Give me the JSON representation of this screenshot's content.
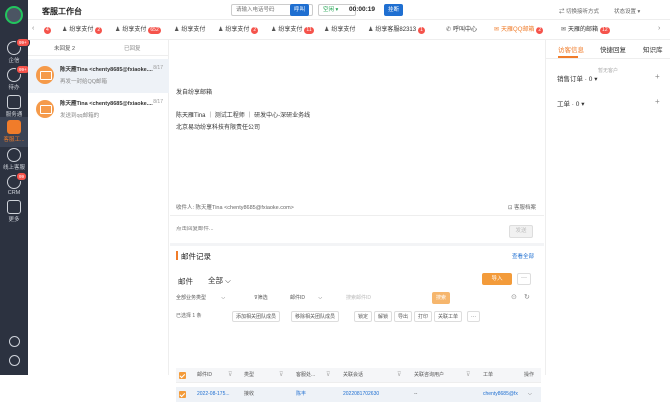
{
  "sidebar": {
    "items": [
      {
        "label": "企信",
        "badge": "99+"
      },
      {
        "label": "待办",
        "badge": "99+"
      },
      {
        "label": "服务通",
        "badge": ""
      },
      {
        "label": "客服工...",
        "badge": ""
      },
      {
        "label": "线上客服",
        "badge": ""
      },
      {
        "label": "CRM",
        "badge": "99"
      },
      {
        "label": "更多",
        "badge": ""
      }
    ]
  },
  "topbar": {
    "title": "客服工作台",
    "phone_placeholder": "请输入电话号码",
    "call_label": "呼叫",
    "status_label": "空闲",
    "timer": "00:00:19",
    "hangup_label": "挂断",
    "switch_label": "切换接听方式",
    "status_setting_label": "状态设置"
  },
  "tabs": [
    {
      "label": "纷享支付",
      "badge": "2",
      "icon": "customer-icon"
    },
    {
      "label": "纷享支付",
      "badge": "652",
      "icon": "customer-icon"
    },
    {
      "label": "纷享支付",
      "badge": "",
      "icon": "customer-icon"
    },
    {
      "label": "纷享支付",
      "badge": "2",
      "icon": "customer-icon"
    },
    {
      "label": "纷享支付",
      "badge": "11",
      "icon": "customer-icon"
    },
    {
      "label": "纷享支付",
      "badge": "",
      "icon": "customer-icon"
    },
    {
      "label": "纷享客服82313",
      "badge": "1",
      "icon": "customer-icon"
    },
    {
      "label": "呼叫中心",
      "badge": "",
      "icon": "phone-icon"
    },
    {
      "label": "天雁QQ邮箱",
      "badge": "2",
      "icon": "mail-icon"
    },
    {
      "label": "天雁的邮箱",
      "badge": "12",
      "icon": "mail-icon"
    }
  ],
  "tabs_left_badge": "4",
  "mail_list": {
    "tab_unread": "未回复 2",
    "tab_replied": "已回复",
    "items": [
      {
        "from": "陈天雁Tina <chenty8685@fxiaoke....",
        "date": "8/17",
        "subject": "再发一封给QQ邮箱"
      },
      {
        "from": "陈天雁Tina <chenty8685@fxiaoke....",
        "date": "8/17",
        "subject": "发送到qq邮箱的"
      }
    ]
  },
  "mail_body": {
    "line1": "发自纷享邮箱",
    "signature": "陈天雁Tina ｜ 测试工程师 ｜ 研发中心-深研业务线",
    "company": "北京易动纷享科技有限责任公司"
  },
  "recipient": "收件人: 陈天雁Tina <chenty8685@fxiaoke.com>",
  "customer_profile": "客服档案",
  "reply_placeholder": "点击回复邮件...",
  "send_label": "发送",
  "records": {
    "title": "邮件记录",
    "view_all": "查看全部",
    "mail_label": "邮件",
    "all_label": "全部",
    "import_label": "导入",
    "more_label": "···",
    "filter_biz": "全部业务类型",
    "filter_label": "筛选",
    "filter_mailid": "邮件ID",
    "search_placeholder": "搜索邮件ID",
    "search_label": "搜索",
    "selected_count": "已选择 1 条",
    "actions": [
      "添加相关团队成员",
      "移除相关团队成员",
      "锁定",
      "解锁",
      "导出",
      "打印",
      "关联工单",
      "···"
    ],
    "columns": [
      "邮件ID",
      "类型",
      "客服处...",
      "关联会话",
      "关联咨询用户",
      "工单",
      "操作"
    ],
    "rows": [
      {
        "mail_id": "2022-08-175...",
        "type": "接收",
        "handler": "陈丰",
        "session": "2022081702630",
        "user": "--",
        "ticket": "chenty8685@fx"
      }
    ]
  },
  "right_panel": {
    "tabs": [
      "访客信息",
      "快捷回复",
      "知识库"
    ],
    "not_bound": "暂无客户",
    "sales_order": "销售订单 · 0",
    "work_order": "工单 · 0"
  },
  "colors": {
    "accent": "#f07c2a",
    "primary": "#1f6fd1",
    "sidebar_bg": "#2c3240",
    "badge": "#f5534b"
  }
}
